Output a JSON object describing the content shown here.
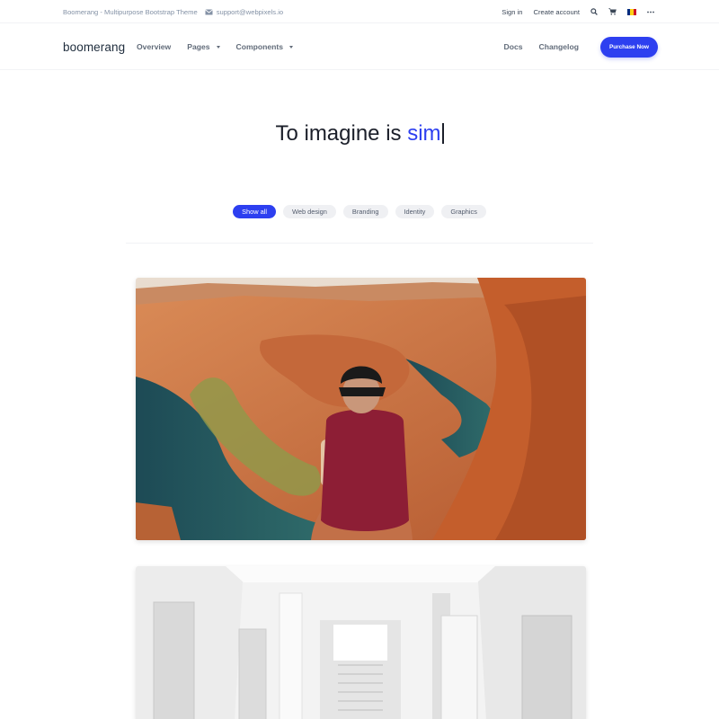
{
  "topbar": {
    "site_title": "Boomerang - Multipurpose Bootstrap Theme",
    "email": "support@webpixels.io",
    "sign_in": "Sign in",
    "create_account": "Create account",
    "icons": [
      "envelope-icon",
      "search-icon",
      "cart-icon",
      "flag-icon",
      "more-icon"
    ],
    "flag_colors": [
      "#002b7f",
      "#fcd116",
      "#ce1126"
    ]
  },
  "navbar": {
    "brand": "boomerang",
    "items": [
      {
        "label": "Overview",
        "dropdown": false
      },
      {
        "label": "Pages",
        "dropdown": true
      },
      {
        "label": "Components",
        "dropdown": true
      }
    ],
    "right_items": [
      "Docs",
      "Changelog"
    ],
    "cta": "Purchase Now"
  },
  "hero": {
    "title_static": "To imagine is ",
    "title_typed": "sim",
    "accent_color": "#2d3ff0"
  },
  "filters": [
    "Show all",
    "Web design",
    "Branding",
    "Identity",
    "Graphics"
  ],
  "active_filter": "Show all",
  "gallery": [
    {
      "image": "canyon-photo"
    },
    {
      "image": "white-interior-photo"
    }
  ]
}
